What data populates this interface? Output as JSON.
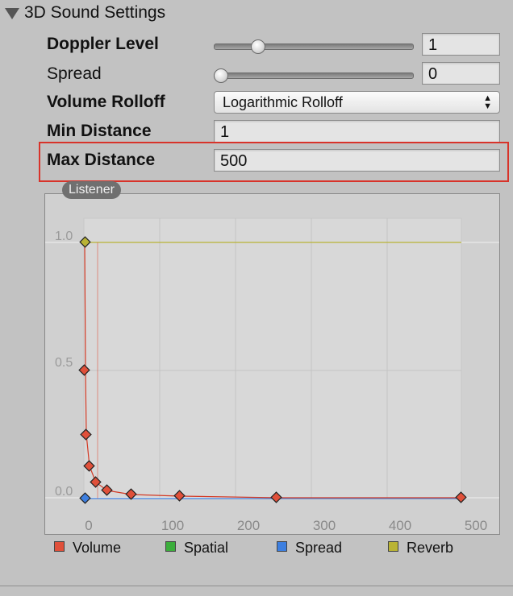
{
  "section": {
    "title": "3D Sound Settings"
  },
  "fields": {
    "doppler_level": {
      "label": "Doppler Level",
      "value": "1",
      "slider_fraction": 0.2
    },
    "spread": {
      "label": "Spread",
      "value": "0",
      "slider_fraction": 0.0
    },
    "volume_rolloff": {
      "label": "Volume Rolloff",
      "value": "Logarithmic Rolloff"
    },
    "min_distance": {
      "label": "Min Distance",
      "value": "1"
    },
    "max_distance": {
      "label": "Max Distance",
      "value": "500"
    }
  },
  "graph": {
    "badge": "Listener",
    "x_ticks": [
      "0",
      "100",
      "200",
      "300",
      "400",
      "500"
    ],
    "y_ticks": [
      "1.0",
      "0.5",
      "0.0"
    ],
    "legend": [
      {
        "label": "Volume",
        "color": "#e0503a"
      },
      {
        "label": "Spatial",
        "color": "#3cae3c"
      },
      {
        "label": "Spread",
        "color": "#3d7fe0"
      },
      {
        "label": "Reverb",
        "color": "#b9b335"
      }
    ]
  }
}
